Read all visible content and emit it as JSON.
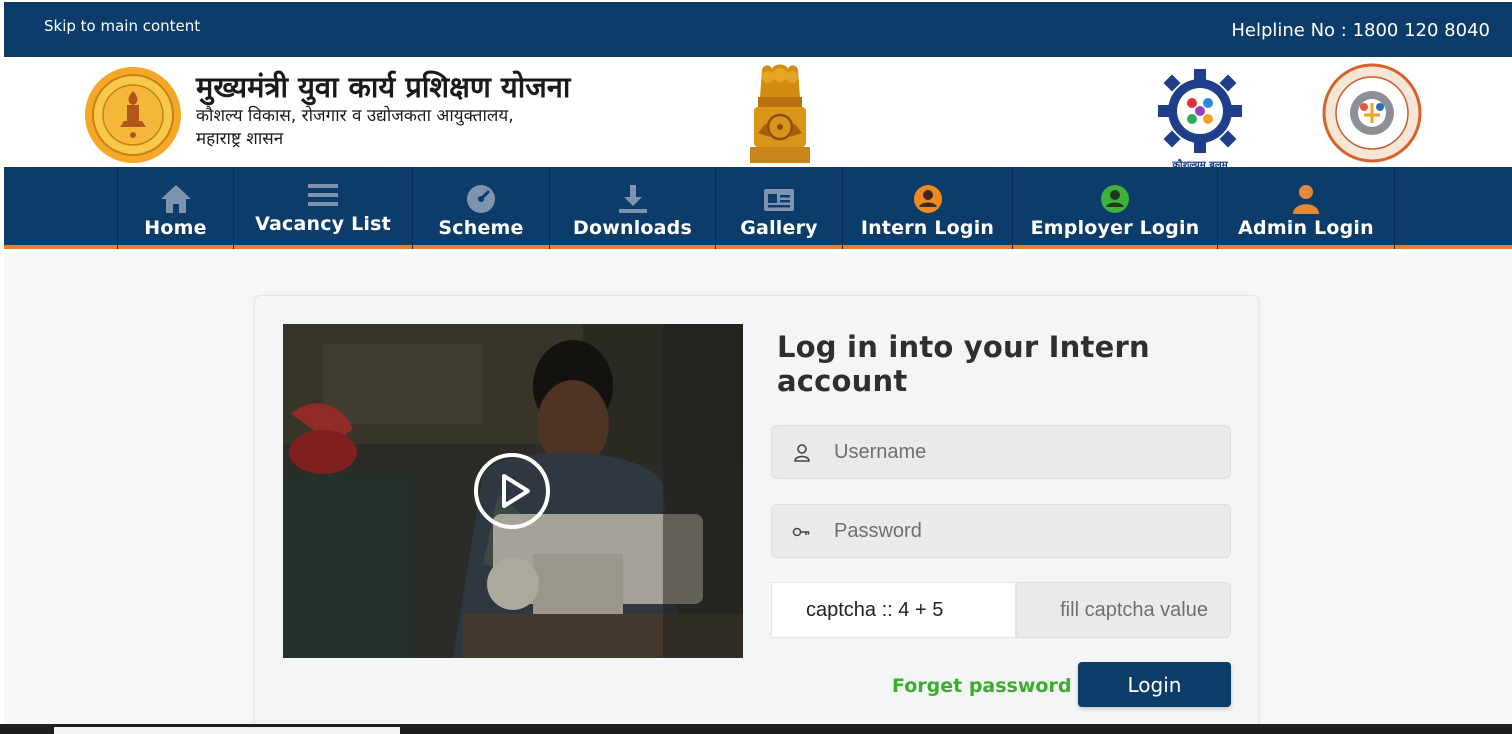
{
  "topbar": {
    "skip_link": "Skip to main content",
    "helpline": "Helpline No : 1800 120 8040"
  },
  "header": {
    "title": "मुख्यमंत्री युवा कार्य प्रशिक्षण योजना",
    "subtitle_line1": "कौशल्य विकास, रोजगार व उद्योजकता आयुक्तालय,",
    "subtitle_line2": "महाराष्ट्र शासन",
    "skill_logo_caption": "कौशल्यम् बलम्"
  },
  "nav": {
    "items": [
      {
        "label": "Home",
        "icon": "home-icon"
      },
      {
        "label": "Vacancy List",
        "icon": "list-icon"
      },
      {
        "label": "Scheme",
        "icon": "gauge-icon"
      },
      {
        "label": "Downloads",
        "icon": "download-icon"
      },
      {
        "label": "Gallery",
        "icon": "id-card-icon"
      },
      {
        "label": "Intern Login",
        "icon": "intern-user-icon"
      },
      {
        "label": "Employer Login",
        "icon": "employer-user-icon"
      },
      {
        "label": "Admin Login",
        "icon": "admin-user-icon"
      }
    ]
  },
  "login": {
    "title": "Log in into your Intern account",
    "username_placeholder": "Username",
    "password_placeholder": "Password",
    "captcha_label": "captcha :: 4 + 5",
    "captcha_placeholder": "fill captcha value",
    "forget_password": "Forget password",
    "login_button": "Login"
  },
  "colors": {
    "primary_navy": "#0c3d6a",
    "accent_orange": "#e8802a",
    "forget_green": "#3aae2a",
    "intern_icon": "#f0891f",
    "employer_icon": "#3fb23a",
    "admin_icon": "#e08a3a"
  }
}
